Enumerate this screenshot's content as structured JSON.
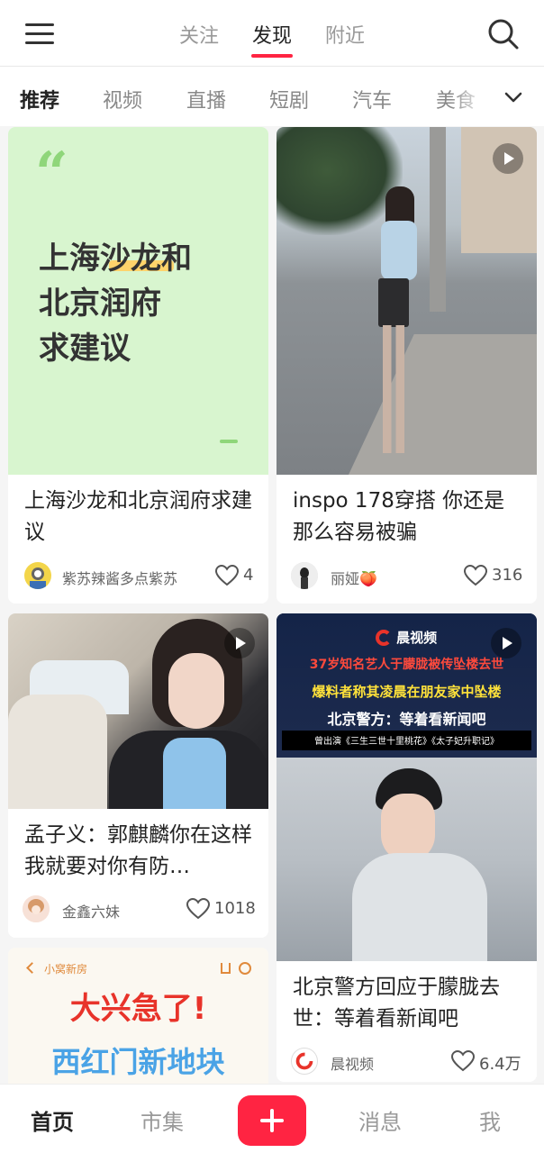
{
  "header": {
    "tabs": [
      {
        "label": "关注"
      },
      {
        "label": "发现",
        "active": true
      },
      {
        "label": "附近"
      }
    ],
    "menu_icon": "hamburger-menu-icon",
    "search_icon": "search-icon"
  },
  "categories": {
    "items": [
      "推荐",
      "视频",
      "直播",
      "短剧",
      "汽车",
      "美食"
    ],
    "active": "推荐",
    "expand_icon": "chevron-down-icon"
  },
  "feed": {
    "cards": [
      {
        "cover_text": [
          "上海沙龙和",
          "北京润府",
          "求建议"
        ],
        "quote_mark": "“",
        "title": "上海沙龙和北京润府求建议",
        "author": "紫苏辣酱多点紫苏",
        "likes": "4"
      },
      {
        "title": "inspo 178穿搭 你还是那么容易被骗",
        "author": "丽娅🍑",
        "likes": "316",
        "is_video": true
      },
      {
        "title": "孟子义：郭麒麟你在这样 我就要对你有防…",
        "author": "金鑫六妹",
        "likes": "1018",
        "is_video": true
      },
      {
        "cover_brand": "晨视频",
        "cover_lines": [
          "37岁知名艺人于朦胧被传坠楼去世",
          "爆料者称其凌晨在朋友家中坠楼",
          "北京警方：等着看新闻吧",
          "曾出演《三生三世十里桃花》《太子妃升职记》"
        ],
        "title": "北京警方回应于朦胧去世：等着看新闻吧",
        "author": "晨视频",
        "likes": "6.4万",
        "is_video": true
      },
      {
        "cover_header": "小窝新房",
        "cover_text": [
          "大兴急了!",
          "西红门新地块"
        ]
      }
    ]
  },
  "bottom_nav": {
    "tabs": [
      "首页",
      "市集",
      "消息",
      "我"
    ],
    "active": "首页",
    "publish_icon": "plus-icon"
  },
  "colors": {
    "accent": "#ff2442",
    "card_bg": "#ffffff",
    "page_bg": "#f5f5f5",
    "cover_green": "#d8f5cf",
    "cover_red": "#e8332a",
    "cover_blue": "#4aa3e6"
  }
}
